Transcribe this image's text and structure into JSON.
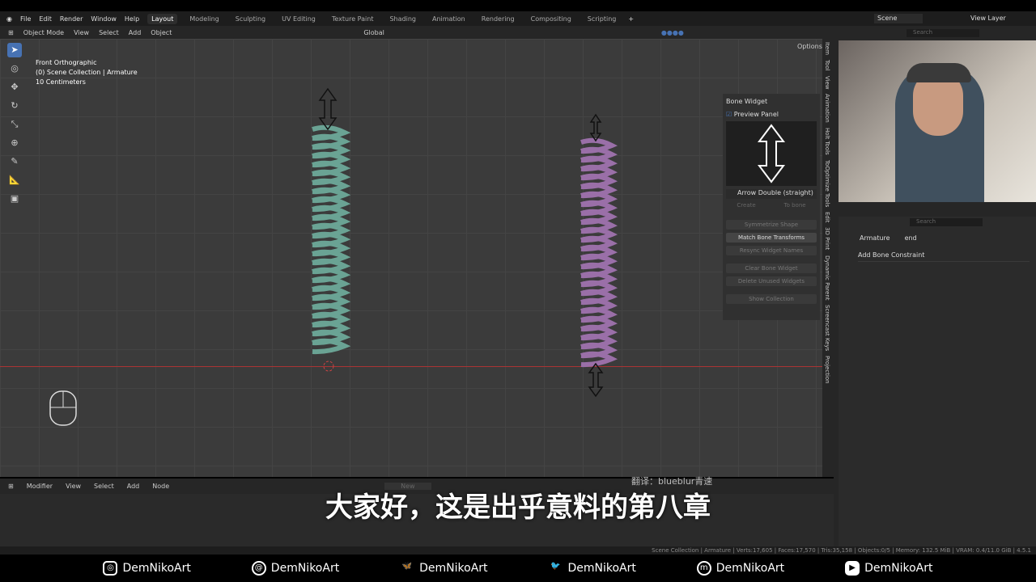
{
  "menu": [
    "File",
    "Edit",
    "Render",
    "Window",
    "Help"
  ],
  "workspaces": [
    "Layout",
    "Modeling",
    "Sculpting",
    "UV Editing",
    "Texture Paint",
    "Shading",
    "Animation",
    "Rendering",
    "Compositing",
    "Scripting"
  ],
  "scene": "Scene",
  "view_layer": "View Layer",
  "header": {
    "mode": "Object Mode",
    "items": [
      "View",
      "Select",
      "Add",
      "Object"
    ],
    "orientation": "Global",
    "options": "Options"
  },
  "overlay": {
    "view": "Front Orthographic",
    "collection": "(0) Scene Collection | Armature",
    "scale": "10 Centimeters"
  },
  "npanel": {
    "title": "Bone Widget",
    "preview": "Preview Panel",
    "shape": "Arrow Double (straight)",
    "create": "Create",
    "to_bone": "To bone",
    "buttons": [
      "Symmetrize Shape",
      "Match Bone Transforms",
      "Resync Widget Names",
      "Clear Bone Widget",
      "Delete Unused Widgets",
      "Show Collection"
    ]
  },
  "side_tabs": [
    "Item",
    "Tool",
    "View",
    "Animation",
    "Holt Tools",
    "ToOptimize Tools",
    "Edit",
    "3D Print",
    "Dynamic Parent",
    "Screencast Keys",
    "Projection"
  ],
  "props": {
    "search": "Search",
    "object": "Armature",
    "bone": "end",
    "add_constraint": "Add Bone Constraint"
  },
  "outliner_search": "Search",
  "bottom": {
    "editor": "Modifier",
    "items": [
      "View",
      "Select",
      "Add",
      "Node"
    ],
    "new": "New"
  },
  "status": "Scene Collection | Armature | Verts:17,605 | Faces:17,570 | Tris:35,158 | Objects:0/5 | Memory: 132.5 MiB | VRAM: 0.4/11.0 GiB | 4.5.1",
  "subtitle": "大家好，这是出乎意料的第八章",
  "credit": "翻译：blueblur青速",
  "social": [
    {
      "icon": "instagram-icon",
      "handle": "DemNikoArt"
    },
    {
      "icon": "threads-icon",
      "handle": "DemNikoArt"
    },
    {
      "icon": "bluesky-icon",
      "handle": "DemNikoArt"
    },
    {
      "icon": "twitter-icon",
      "handle": "DemNikoArt"
    },
    {
      "icon": "mastodon-icon",
      "handle": "DemNikoArt"
    },
    {
      "icon": "youtube-icon",
      "handle": "DemNikoArt"
    }
  ],
  "colors": {
    "green_spring": "#6aa394",
    "purple_spring": "#9a6fa8",
    "accent": "#4772b3"
  }
}
